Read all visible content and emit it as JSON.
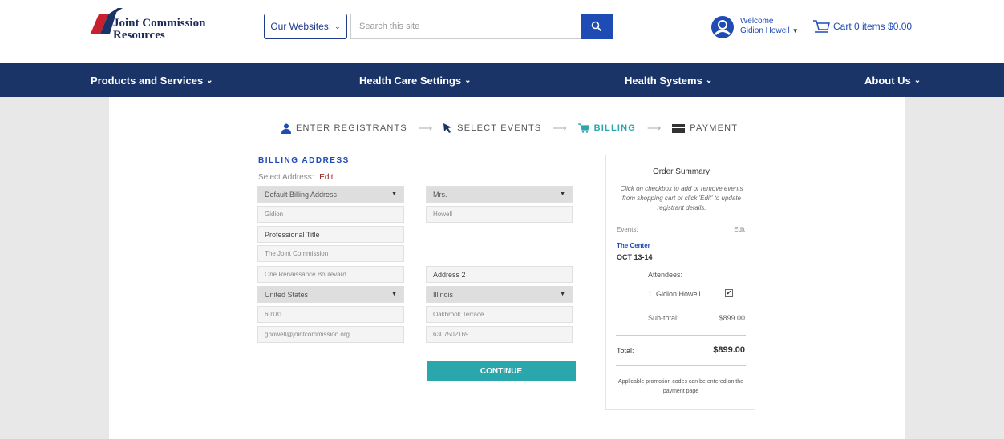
{
  "header": {
    "logo_line1": "Joint Commission",
    "logo_line2": "Resources",
    "websites_label": "Our Websites:",
    "search_placeholder": "Search this site",
    "welcome_label": "Welcome",
    "user_name": "Gidion Howell",
    "cart_label": "Cart 0 items $0.00"
  },
  "nav": {
    "items": [
      {
        "label": "Products and Services"
      },
      {
        "label": "Health Care Settings"
      },
      {
        "label": "Health Systems"
      },
      {
        "label": "About Us"
      }
    ]
  },
  "steps": [
    {
      "label": "ENTER REGISTRANTS"
    },
    {
      "label": "SELECT EVENTS"
    },
    {
      "label": "BILLING"
    },
    {
      "label": "PAYMENT"
    }
  ],
  "form": {
    "section_title": "BILLING ADDRESS",
    "select_address_label": "Select Address:",
    "select_address_edit": "Edit",
    "address_select": "Default Billing Address",
    "salutation": "Mrs.",
    "first_name": "Gidion",
    "last_name": "Howell",
    "professional_title": "Professional Title",
    "organization": "The Joint Commission",
    "address1": "One Renaissance Boulevard",
    "address2": "Address 2",
    "country": "United States",
    "state": "Illinois",
    "zip": "60181",
    "city": "Oakbrook Terrace",
    "email": "ghowell@jointcommission.org",
    "phone": "6307502169",
    "continue_label": "CONTINUE"
  },
  "summary": {
    "title": "Order Summary",
    "description": "Click on checkbox to add or remove events from shopping cart or click 'Edit' to update registrant details.",
    "events_label": "Events:",
    "edit_label": "Edit",
    "event_name": "The Center",
    "event_date": "OCT 13-14",
    "attendees_label": "Attendees:",
    "attendee": "1. Gidion Howell",
    "check_mark": "✔",
    "subtotal_label": "Sub-total:",
    "subtotal_value": "$899.00",
    "total_label": "Total:",
    "total_value": "$899.00",
    "promo_text": "Applicable promotion codes can be entered on the payment page"
  },
  "colors": {
    "nav_bg": "#1b3468",
    "accent_teal": "#2aa7ad",
    "link_blue": "#1f4bb5"
  }
}
